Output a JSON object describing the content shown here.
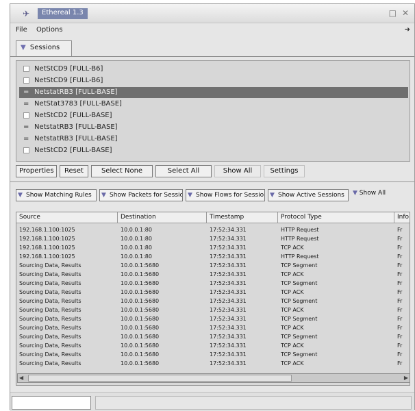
{
  "window": {
    "title": "Ethereal 1.3",
    "minimize_glyph": "□",
    "close_glyph": "✕"
  },
  "menu": {
    "items": [
      "File",
      "Options"
    ],
    "arrow_glyph": "➜"
  },
  "tab": {
    "label": "Sessions",
    "tri": "▼"
  },
  "sessions": [
    "NetStCD9 [FULL-B6]",
    "NetStCD9 [FULL-B6]",
    "NetstatRB3 [FULL-BASE]",
    "NetStat3783 [FULL-BASE]",
    "NetStCD2 [FULL-BASE]",
    "NetstatRB3 [FULL-BASE]",
    "NetstatRB3 [FULL-BASE]",
    "NetStCD2 [FULL-BASE]"
  ],
  "session_marks": [
    "",
    "",
    "=",
    "=",
    "",
    "=",
    "=",
    ""
  ],
  "buttons": [
    "Properties",
    "Reset",
    "Select None",
    "Select All",
    "Show All",
    "Settings"
  ],
  "filters": [
    "Show Matching Rules",
    "Show Packets for Session",
    "Show Flows for Session",
    "Show Active Sessions"
  ],
  "filter_extra": "Show All",
  "tri": "▼",
  "table": {
    "headers": [
      "Source",
      "Destination",
      "Timestamp",
      "Protocol Type",
      "Info"
    ],
    "rows": [
      [
        "192.168.1.100:1025",
        "10.0.0.1:80",
        "17:52:34.331",
        "HTTP Request",
        "Fr"
      ],
      [
        "192.168.1.100:1025",
        "10.0.0.1:80",
        "17:52:34.331",
        "HTTP Request",
        "Fr"
      ],
      [
        "192.168.1.100:1025",
        "10.0.0.1:80",
        "17:52:34.331",
        "TCP ACK",
        "Fr"
      ],
      [
        "192.168.1.100:1025",
        "10.0.0.1:80",
        "17:52:34.331",
        "HTTP Request",
        "Fr"
      ],
      [
        "Sourcing Data, Results",
        "10.0.0.1:5680",
        "17:52:34.331",
        "TCP Segment",
        "Fr"
      ],
      [
        "Sourcing Data, Results",
        "10.0.0.1:5680",
        "17:52:34.331",
        "TCP ACK",
        "Fr"
      ],
      [
        "Sourcing Data, Results",
        "10.0.0.1:5680",
        "17:52:34.331",
        "TCP Segment",
        "Fr"
      ],
      [
        "Sourcing Data, Results",
        "10.0.0.1:5680",
        "17:52:34.331",
        "TCP ACK",
        "Fr"
      ],
      [
        "Sourcing Data, Results",
        "10.0.0.1:5680",
        "17:52:34.331",
        "TCP Segment",
        "Fr"
      ],
      [
        "Sourcing Data, Results",
        "10.0.0.1:5680",
        "17:52:34.331",
        "TCP ACK",
        "Fr"
      ],
      [
        "Sourcing Data, Results",
        "10.0.0.1:5680",
        "17:52:34.331",
        "TCP Segment",
        "Fr"
      ],
      [
        "Sourcing Data, Results",
        "10.0.0.1:5680",
        "17:52:34.331",
        "TCP ACK",
        "Fr"
      ],
      [
        "Sourcing Data, Results",
        "10.0.0.1:5680",
        "17:52:34.331",
        "TCP Segment",
        "Fr"
      ],
      [
        "Sourcing Data, Results",
        "10.0.0.1:5680",
        "17:52:34.331",
        "TCP ACK",
        "Fr"
      ],
      [
        "Sourcing Data, Results",
        "10.0.0.1:5680",
        "17:52:34.331",
        "TCP Segment",
        "Fr"
      ],
      [
        "Sourcing Data, Results",
        "10.0.0.1:5680",
        "17:52:34.331",
        "TCP ACK",
        "Fr"
      ]
    ]
  },
  "scroll": {
    "left_glyph": "◀",
    "right_glyph": "▶"
  },
  "status": {
    "input_value": "",
    "field_text": ""
  }
}
